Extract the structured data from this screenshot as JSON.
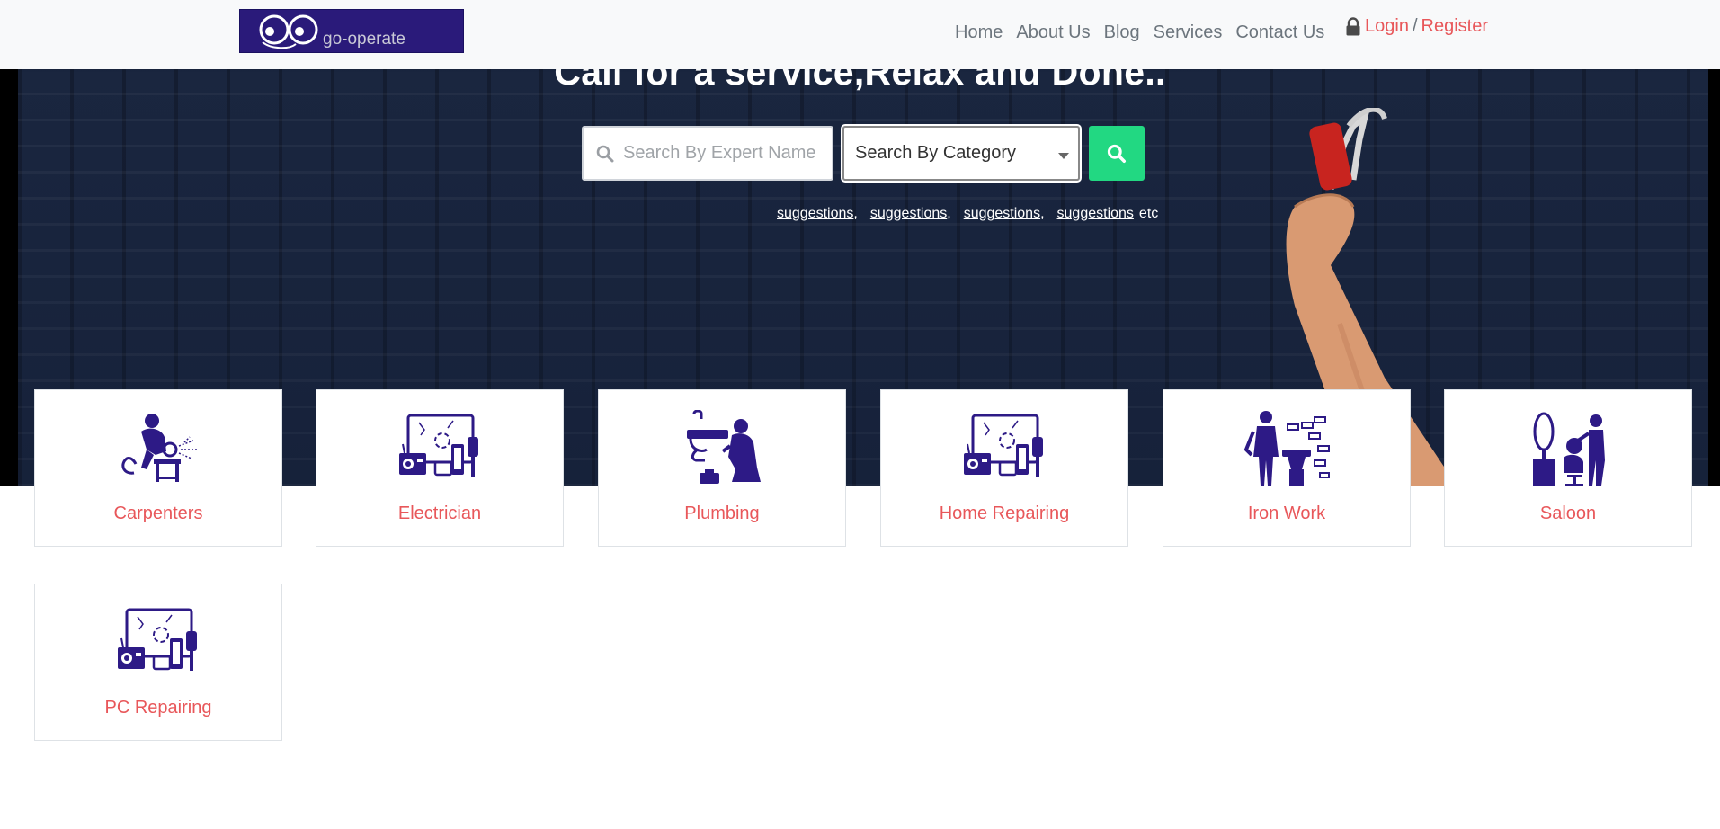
{
  "brand": {
    "logo_text": "go-operate",
    "colors": {
      "accent": "#e8575a",
      "nav_text": "#6c757d",
      "icon": "#2d1a86",
      "search_button": "#22d882",
      "logo_bg": "#2a1a7a"
    }
  },
  "nav": {
    "links": [
      "Home",
      "About Us",
      "Blog",
      "Services",
      "Contact Us"
    ],
    "login": "Login",
    "separator": "/",
    "register": "Register",
    "lock_icon": "lock-icon"
  },
  "hero": {
    "title": "Call for a service,Relax and Done..",
    "search": {
      "placeholder": "Search By Expert Name",
      "category_selected": "Search By Category",
      "button_icon": "search-icon"
    },
    "suggestions": [
      "suggestions",
      "suggestions",
      "suggestions",
      "suggestions"
    ],
    "suggestions_suffix": "etc"
  },
  "categories": [
    {
      "label": "Carpenters",
      "icon": "welder-icon"
    },
    {
      "label": "Electrician",
      "icon": "electronics-icon"
    },
    {
      "label": "Plumbing",
      "icon": "plumber-icon"
    },
    {
      "label": "Home Repairing",
      "icon": "electronics-icon"
    },
    {
      "label": "Iron Work",
      "icon": "blacksmith-icon"
    },
    {
      "label": "Saloon",
      "icon": "barber-icon"
    },
    {
      "label": "PC Repairing",
      "icon": "electronics-icon"
    }
  ]
}
